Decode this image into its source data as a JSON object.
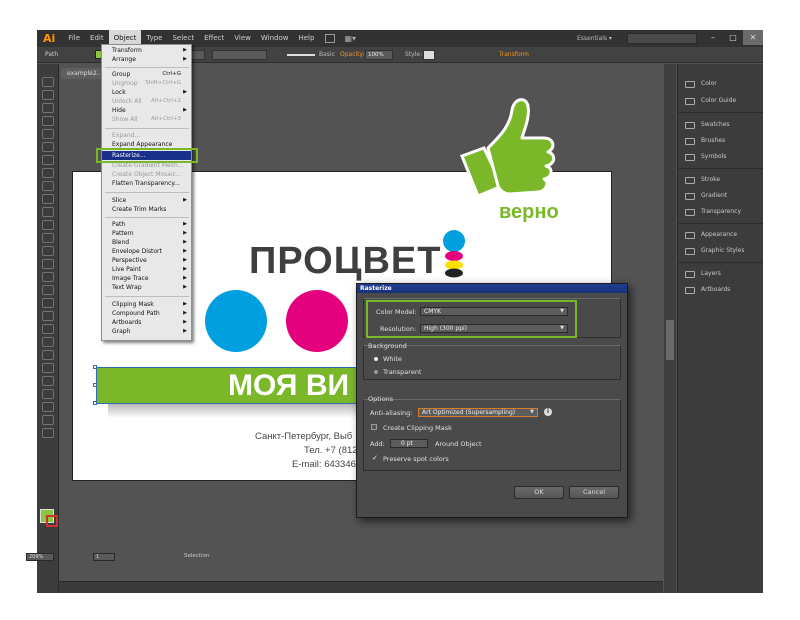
{
  "app": {
    "logo": "Ai"
  },
  "menubar": {
    "items": [
      "File",
      "Edit",
      "Object",
      "Type",
      "Select",
      "Effect",
      "View",
      "Window",
      "Help"
    ],
    "workspace": "Essentials ▾",
    "window_buttons": [
      "–",
      "□",
      "✕"
    ]
  },
  "controlbar": {
    "selection_label": "Path",
    "stroke_style": "Basic",
    "opacity_label": "Opacity:",
    "opacity_value": "100%",
    "style_label": "Style:",
    "transform_label": "Transform",
    "fill_color": "#8cc63f"
  },
  "document": {
    "tab_label": "example2..."
  },
  "artwork": {
    "title": "ПРОЦВЕТ",
    "band_text": "МОЯ ВИ",
    "address": "Санкт-Петербург, Выб",
    "phone": "Тел. +7 (812",
    "email": "E-mail: 643346",
    "annotation": "верно",
    "accent_green": "#7ab829",
    "cyan": "#00a0e0",
    "magenta": "#e5007e"
  },
  "object_menu": {
    "items": [
      {
        "label": "Transform",
        "submenu": true
      },
      {
        "label": "Arrange",
        "submenu": true
      },
      {
        "label": "Group",
        "shortcut": "Ctrl+G"
      },
      {
        "label": "Ungroup",
        "shortcut": "Shift+Ctrl+G",
        "disabled": true
      },
      {
        "label": "Lock",
        "submenu": true
      },
      {
        "label": "Unlock All",
        "shortcut": "Alt+Ctrl+2",
        "disabled": true
      },
      {
        "label": "Hide",
        "submenu": true
      },
      {
        "label": "Show All",
        "shortcut": "Alt+Ctrl+3",
        "disabled": true
      },
      {
        "label": "Expand...",
        "disabled": true
      },
      {
        "label": "Expand Appearance"
      },
      {
        "label": "Rasterize...",
        "highlighted": true
      },
      {
        "label": "Create Gradient Mesh...",
        "disabled": true
      },
      {
        "label": "Create Object Mosaic...",
        "disabled": true
      },
      {
        "label": "Flatten Transparency..."
      },
      {
        "label": "Slice",
        "submenu": true
      },
      {
        "label": "Create Trim Marks"
      },
      {
        "label": "Path",
        "submenu": true
      },
      {
        "label": "Pattern",
        "submenu": true
      },
      {
        "label": "Blend",
        "submenu": true
      },
      {
        "label": "Envelope Distort",
        "submenu": true
      },
      {
        "label": "Perspective",
        "submenu": true
      },
      {
        "label": "Live Paint",
        "submenu": true
      },
      {
        "label": "Image Trace",
        "submenu": true
      },
      {
        "label": "Text Wrap",
        "submenu": true
      },
      {
        "label": "Clipping Mask",
        "submenu": true
      },
      {
        "label": "Compound Path",
        "submenu": true
      },
      {
        "label": "Artboards",
        "submenu": true
      },
      {
        "label": "Graph",
        "submenu": true
      }
    ]
  },
  "right_panels": {
    "items": [
      {
        "label": "Color",
        "icon": "color-icon"
      },
      {
        "label": "Color Guide",
        "icon": "color-guide-icon"
      },
      {
        "label": "Swatches",
        "icon": "swatches-icon"
      },
      {
        "label": "Brushes",
        "icon": "brushes-icon"
      },
      {
        "label": "Symbols",
        "icon": "symbols-icon"
      },
      {
        "label": "Stroke",
        "icon": "stroke-icon"
      },
      {
        "label": "Gradient",
        "icon": "gradient-icon"
      },
      {
        "label": "Transparency",
        "icon": "transparency-icon"
      },
      {
        "label": "Appearance",
        "icon": "appearance-icon"
      },
      {
        "label": "Graphic Styles",
        "icon": "graphic-styles-icon"
      },
      {
        "label": "Layers",
        "icon": "layers-icon"
      },
      {
        "label": "Artboards",
        "icon": "artboards-icon"
      }
    ]
  },
  "statusbar": {
    "zoom": "209%",
    "page": "1",
    "mode": "Selection"
  },
  "rasterize_dialog": {
    "title": "Rasterize",
    "color_model_label": "Color Model:",
    "color_model_value": "CMYK",
    "resolution_label": "Resolution:",
    "resolution_value": "High (300 ppi)",
    "background_label": "Background",
    "bg_white": "White",
    "bg_transparent": "Transparent",
    "options_label": "Options",
    "antialiasing_label": "Anti-aliasing:",
    "antialiasing_value": "Art Optimized (Supersampling)",
    "clipping_mask_label": "Create Clipping Mask",
    "add_label": "Add:",
    "add_value": "0 pt",
    "around_object_label": "Around Object",
    "preserve_spot_label": "Preserve spot colors",
    "ok_label": "OK",
    "cancel_label": "Cancel"
  }
}
